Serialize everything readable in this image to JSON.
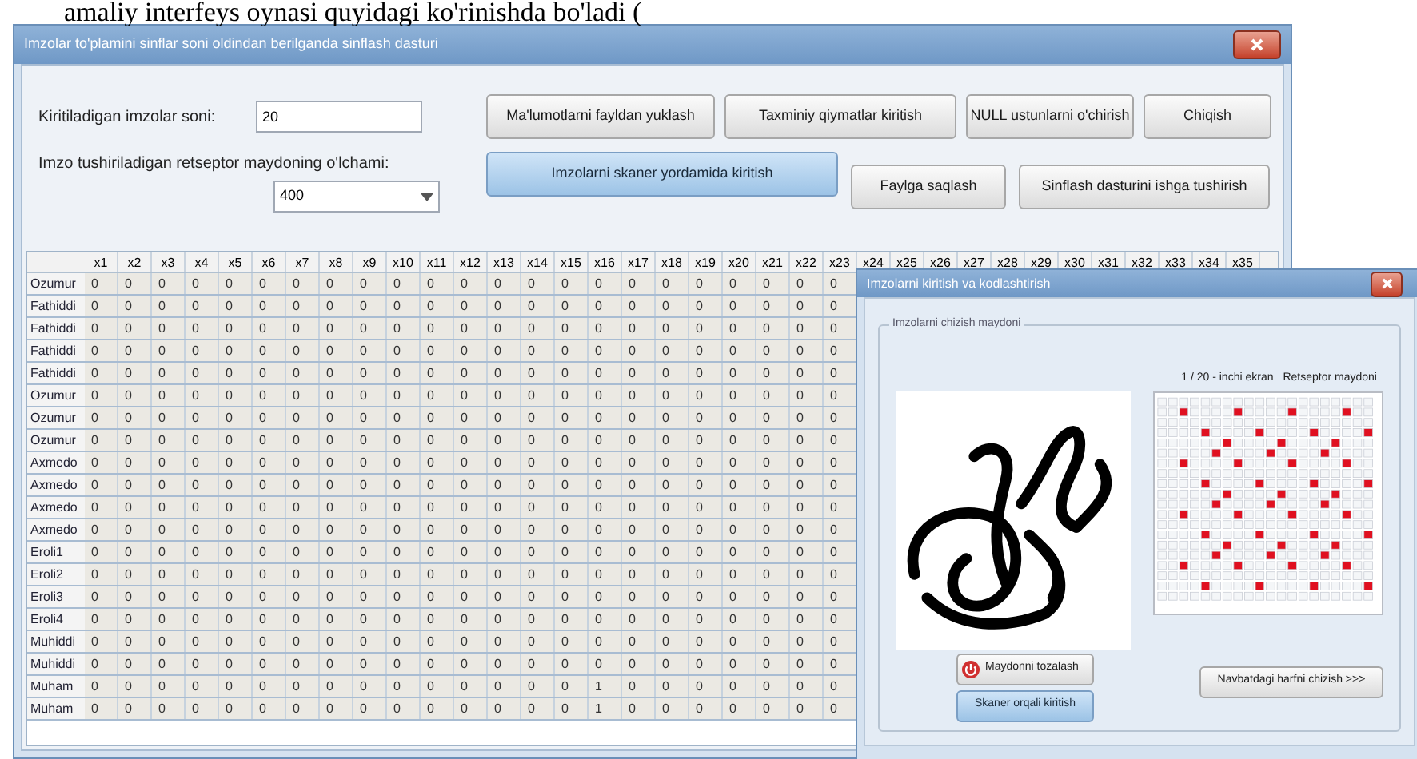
{
  "document_text": "amaliy interfeys oynasi quyidagi ko'rinishda bo'ladi (",
  "window": {
    "title": "Imzolar to'plamini sinflar soni oldindan berilganda sinflash dasturi"
  },
  "form": {
    "count_label": "Kiritiladigan imzolar soni:",
    "count_value": "20",
    "size_label": "Imzo tushiriladigan retseptor maydoning o'lchami:",
    "size_value": "400"
  },
  "buttons_top": [
    {
      "label": "Ma'lumotlarni fayldan yuklash",
      "highlighted": false
    },
    {
      "label": "Taxminiy qiymatlar kiritish",
      "highlighted": false
    },
    {
      "label": "NULL ustunlarni o'chirish",
      "highlighted": false
    },
    {
      "label": "Chiqish",
      "highlighted": false
    }
  ],
  "buttons_bottom": [
    {
      "label": "Imzolarni skaner yordamida kiritish",
      "highlighted": true
    },
    {
      "label": "Faylga saqlash",
      "highlighted": false
    },
    {
      "label": "Sinflash dasturini ishga tushirish",
      "highlighted": false
    }
  ],
  "table": {
    "columns": [
      "x1",
      "x2",
      "x3",
      "x4",
      "x5",
      "x6",
      "x7",
      "x8",
      "x9",
      "x10",
      "x11",
      "x12",
      "x13",
      "x14",
      "x15",
      "x16",
      "x17",
      "x18",
      "x19",
      "x20",
      "x21",
      "x22",
      "x23",
      "x24",
      "x25",
      "x26",
      "x27",
      "x28",
      "x29",
      "x30",
      "x31",
      "x32",
      "x33",
      "x34",
      "x35"
    ],
    "rows": [
      {
        "name": "Ozumur",
        "cells": [
          "0",
          "0",
          "0",
          "0",
          "0",
          "0",
          "0",
          "0",
          "0",
          "0",
          "0",
          "0",
          "0",
          "0",
          "0",
          "0",
          "0",
          "0",
          "0",
          "0",
          "0",
          "0",
          "0"
        ]
      },
      {
        "name": "Fathiddi",
        "cells": [
          "0",
          "0",
          "0",
          "0",
          "0",
          "0",
          "0",
          "0",
          "0",
          "0",
          "0",
          "0",
          "0",
          "0",
          "0",
          "0",
          "0",
          "0",
          "0",
          "0",
          "0",
          "0",
          "0"
        ]
      },
      {
        "name": "Fathiddi",
        "cells": [
          "0",
          "0",
          "0",
          "0",
          "0",
          "0",
          "0",
          "0",
          "0",
          "0",
          "0",
          "0",
          "0",
          "0",
          "0",
          "0",
          "0",
          "0",
          "0",
          "0",
          "0",
          "0",
          "0"
        ]
      },
      {
        "name": "Fathiddi",
        "cells": [
          "0",
          "0",
          "0",
          "0",
          "0",
          "0",
          "0",
          "0",
          "0",
          "0",
          "0",
          "0",
          "0",
          "0",
          "0",
          "0",
          "0",
          "0",
          "0",
          "0",
          "0",
          "0",
          "0"
        ]
      },
      {
        "name": "Fathiddi",
        "cells": [
          "0",
          "0",
          "0",
          "0",
          "0",
          "0",
          "0",
          "0",
          "0",
          "0",
          "0",
          "0",
          "0",
          "0",
          "0",
          "0",
          "0",
          "0",
          "0",
          "0",
          "0",
          "0",
          "0"
        ]
      },
      {
        "name": "Ozumur",
        "cells": [
          "0",
          "0",
          "0",
          "0",
          "0",
          "0",
          "0",
          "0",
          "0",
          "0",
          "0",
          "0",
          "0",
          "0",
          "0",
          "0",
          "0",
          "0",
          "0",
          "0",
          "0",
          "0",
          "0"
        ]
      },
      {
        "name": "Ozumur",
        "cells": [
          "0",
          "0",
          "0",
          "0",
          "0",
          "0",
          "0",
          "0",
          "0",
          "0",
          "0",
          "0",
          "0",
          "0",
          "0",
          "0",
          "0",
          "0",
          "0",
          "0",
          "0",
          "0",
          "0"
        ]
      },
      {
        "name": "Ozumur",
        "cells": [
          "0",
          "0",
          "0",
          "0",
          "0",
          "0",
          "0",
          "0",
          "0",
          "0",
          "0",
          "0",
          "0",
          "0",
          "0",
          "0",
          "0",
          "0",
          "0",
          "0",
          "0",
          "0",
          "0"
        ]
      },
      {
        "name": "Axmedo",
        "cells": [
          "0",
          "0",
          "0",
          "0",
          "0",
          "0",
          "0",
          "0",
          "0",
          "0",
          "0",
          "0",
          "0",
          "0",
          "0",
          "0",
          "0",
          "0",
          "0",
          "0",
          "0",
          "0",
          "0"
        ]
      },
      {
        "name": "Axmedo",
        "cells": [
          "0",
          "0",
          "0",
          "0",
          "0",
          "0",
          "0",
          "0",
          "0",
          "0",
          "0",
          "0",
          "0",
          "0",
          "0",
          "0",
          "0",
          "0",
          "0",
          "0",
          "0",
          "0",
          "0"
        ]
      },
      {
        "name": "Axmedo",
        "cells": [
          "0",
          "0",
          "0",
          "0",
          "0",
          "0",
          "0",
          "0",
          "0",
          "0",
          "0",
          "0",
          "0",
          "0",
          "0",
          "0",
          "0",
          "0",
          "0",
          "0",
          "0",
          "0",
          "0"
        ]
      },
      {
        "name": "Axmedo",
        "cells": [
          "0",
          "0",
          "0",
          "0",
          "0",
          "0",
          "0",
          "0",
          "0",
          "0",
          "0",
          "0",
          "0",
          "0",
          "0",
          "0",
          "0",
          "0",
          "0",
          "0",
          "0",
          "0",
          "0"
        ]
      },
      {
        "name": "Eroli1",
        "cells": [
          "0",
          "0",
          "0",
          "0",
          "0",
          "0",
          "0",
          "0",
          "0",
          "0",
          "0",
          "0",
          "0",
          "0",
          "0",
          "0",
          "0",
          "0",
          "0",
          "0",
          "0",
          "0",
          "0"
        ]
      },
      {
        "name": "Eroli2",
        "cells": [
          "0",
          "0",
          "0",
          "0",
          "0",
          "0",
          "0",
          "0",
          "0",
          "0",
          "0",
          "0",
          "0",
          "0",
          "0",
          "0",
          "0",
          "0",
          "0",
          "0",
          "0",
          "0",
          "0"
        ]
      },
      {
        "name": "Eroli3",
        "cells": [
          "0",
          "0",
          "0",
          "0",
          "0",
          "0",
          "0",
          "0",
          "0",
          "0",
          "0",
          "0",
          "0",
          "0",
          "0",
          "0",
          "0",
          "0",
          "0",
          "0",
          "0",
          "0",
          "0"
        ]
      },
      {
        "name": "Eroli4",
        "cells": [
          "0",
          "0",
          "0",
          "0",
          "0",
          "0",
          "0",
          "0",
          "0",
          "0",
          "0",
          "0",
          "0",
          "0",
          "0",
          "0",
          "0",
          "0",
          "0",
          "0",
          "0",
          "0",
          "0"
        ]
      },
      {
        "name": "Muhiddi",
        "cells": [
          "0",
          "0",
          "0",
          "0",
          "0",
          "0",
          "0",
          "0",
          "0",
          "0",
          "0",
          "0",
          "0",
          "0",
          "0",
          "0",
          "0",
          "0",
          "0",
          "0",
          "0",
          "0",
          "0"
        ]
      },
      {
        "name": "Muhiddi",
        "cells": [
          "0",
          "0",
          "0",
          "0",
          "0",
          "0",
          "0",
          "0",
          "0",
          "0",
          "0",
          "0",
          "0",
          "0",
          "0",
          "0",
          "0",
          "0",
          "0",
          "0",
          "0",
          "0",
          "0"
        ]
      },
      {
        "name": "Muham",
        "cells": [
          "0",
          "0",
          "0",
          "0",
          "0",
          "0",
          "0",
          "0",
          "0",
          "0",
          "0",
          "0",
          "0",
          "0",
          "0",
          "1",
          "0",
          "0",
          "0",
          "0",
          "0",
          "0",
          "0"
        ]
      },
      {
        "name": "Muham",
        "cells": [
          "0",
          "0",
          "0",
          "0",
          "0",
          "0",
          "0",
          "0",
          "0",
          "0",
          "0",
          "0",
          "0",
          "0",
          "0",
          "1",
          "0",
          "0",
          "0",
          "0",
          "0",
          "0",
          "0"
        ]
      }
    ]
  },
  "dialog": {
    "title": "Imzolarni kiritish va kodlashtirish",
    "group_label": "Imzolarni chizish maydoni",
    "screen_label": "1 / 20 - inchi ekran",
    "grid_label": "Retseptor maydoni",
    "buttons": [
      {
        "label": "Maydonni tozalash",
        "kind": "icon",
        "highlighted": false
      },
      {
        "label": "Skaner orqali kiritish",
        "kind": "plain",
        "highlighted": true
      },
      {
        "label": "Navbatdagi harfni chizish >>>",
        "kind": "plain",
        "highlighted": false
      }
    ]
  }
}
